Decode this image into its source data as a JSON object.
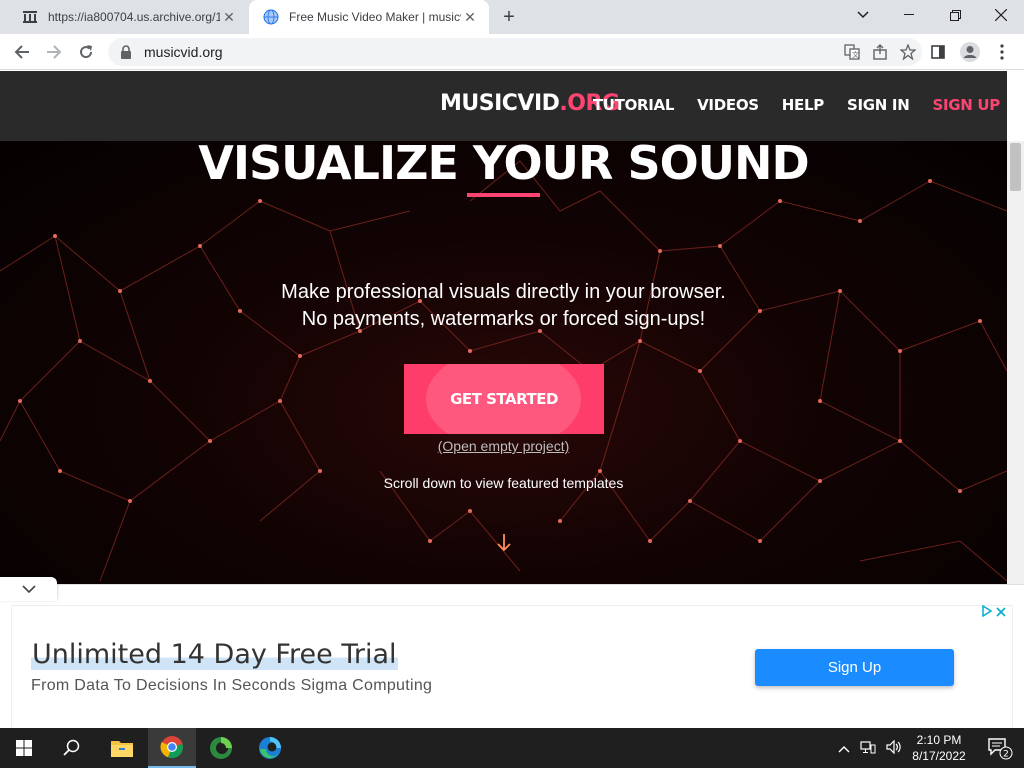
{
  "browser": {
    "tabs": [
      {
        "title": "https://ia800704.us.archive.org/1",
        "active": false,
        "favicon": "archive-icon"
      },
      {
        "title": "Free Music Video Maker | musicvid",
        "active": true,
        "favicon": "globe-icon"
      }
    ],
    "new_tab_symbol": "+",
    "url": "musicvid.org",
    "colors": {
      "tabstrip": "#dee1e6",
      "toolbar": "#ffffff"
    }
  },
  "site": {
    "logo": {
      "main": "MUSICVID",
      "suffix": ".ORG"
    },
    "nav": [
      {
        "label": "TUTORIAL"
      },
      {
        "label": "VIDEOS"
      },
      {
        "label": "HELP"
      },
      {
        "label": "SIGN IN"
      },
      {
        "label": "SIGN UP",
        "accent": true
      }
    ],
    "headline": "VISUALIZE YOUR SOUND",
    "subtext_line1": "Make professional visuals directly in your browser.",
    "subtext_line2": "No payments, watermarks or forced sign-ups!",
    "cta_label": "GET STARTED",
    "empty_project_link": "(Open empty project)",
    "scroll_hint": "Scroll down to view featured templates",
    "colors": {
      "accent": "#ff4472",
      "nav_bg": "#2a2a2a",
      "hero_bg": "#000000",
      "cta": "#ff3d6b"
    }
  },
  "ad": {
    "title": "Unlimited 14 Day Free Trial",
    "subtitle": "From Data To Decisions In Seconds Sigma Computing",
    "button_label": "Sign Up",
    "button_color": "#1a8cff"
  },
  "taskbar": {
    "time": "2:10 PM",
    "date": "8/17/2022",
    "notification_count": "2",
    "apps": [
      "windows-start-icon",
      "search-icon",
      "file-explorer-icon",
      "chrome-icon",
      "edge-dev-icon",
      "edge-icon"
    ]
  }
}
